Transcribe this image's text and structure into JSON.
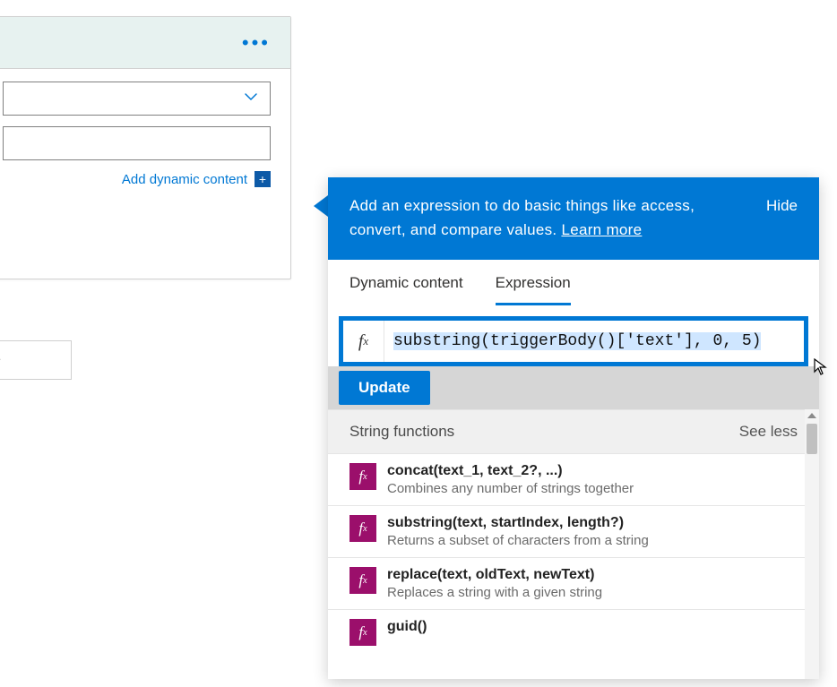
{
  "card": {
    "more_label": "•••",
    "add_dynamic_content": "Add dynamic content"
  },
  "stray": {
    "text": "ve"
  },
  "panel": {
    "header_line1": "Add an expression to do basic things like access,",
    "header_line2_prefix": "convert, and compare values. ",
    "learn_more": "Learn more",
    "hide": "Hide",
    "tabs": {
      "dynamic": "Dynamic content",
      "expression": "Expression",
      "active": "expression"
    },
    "fx_value": "substring(triggerBody()['text'], 0, 5)",
    "update": "Update",
    "section": {
      "title": "String functions",
      "see_less": "See less"
    },
    "functions": [
      {
        "signature": "concat(text_1, text_2?, ...)",
        "description": "Combines any number of strings together"
      },
      {
        "signature": "substring(text, startIndex, length?)",
        "description": "Returns a subset of characters from a string"
      },
      {
        "signature": "replace(text, oldText, newText)",
        "description": "Replaces a string with a given string"
      },
      {
        "signature": "guid()",
        "description": ""
      }
    ]
  },
  "colors": {
    "accent": "#0078d4",
    "fx_badge": "#9b0f6b",
    "header_bg": "#e7f2f0"
  }
}
